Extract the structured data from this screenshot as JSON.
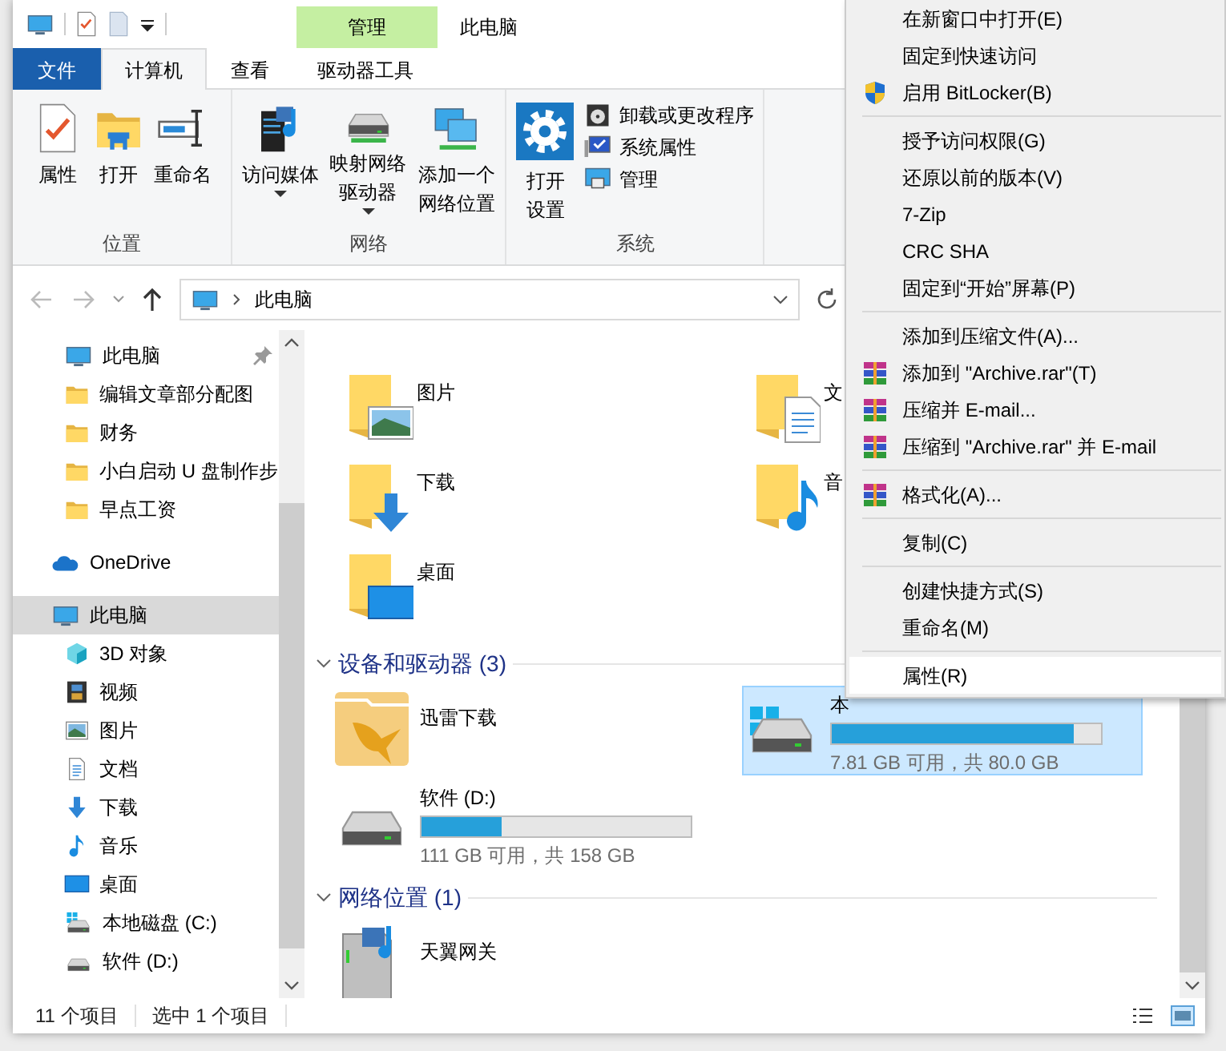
{
  "title_bar": {
    "title": "此电脑",
    "context_tab": "管理"
  },
  "ribbon": {
    "tabs": [
      {
        "label": "文件",
        "kind": "file",
        "selected": false
      },
      {
        "label": "计算机",
        "kind": "tab",
        "selected": true
      },
      {
        "label": "查看",
        "kind": "tab",
        "selected": false
      },
      {
        "label": "驱动器工具",
        "kind": "tab",
        "selected": false
      }
    ],
    "groups": [
      {
        "label": "位置",
        "buttons": [
          {
            "label": "属性",
            "kind": "large",
            "dropdown": false
          },
          {
            "label": "打开",
            "kind": "large",
            "dropdown": false
          },
          {
            "label": "重命名",
            "kind": "large",
            "dropdown": false
          }
        ]
      },
      {
        "label": "网络",
        "buttons": [
          {
            "label": "访问媒体",
            "kind": "large",
            "dropdown": true
          },
          {
            "label": "映射网络驱动器",
            "kind": "large",
            "dropdown": true
          },
          {
            "label": "添加一个网络位置",
            "kind": "large",
            "dropdown": false
          }
        ]
      },
      {
        "label": "系统",
        "buttons": [
          {
            "label": "打开设置",
            "kind": "large",
            "dropdown": false
          },
          {
            "label": "卸载或更改程序",
            "kind": "small"
          },
          {
            "label": "系统属性",
            "kind": "small"
          },
          {
            "label": "管理",
            "kind": "small"
          }
        ]
      }
    ]
  },
  "address_bar": {
    "back_disabled": true,
    "forward_disabled": true,
    "path": "此电脑"
  },
  "nav_pane": {
    "quick_access_items": [
      {
        "label": "此电脑",
        "kind": "computer",
        "pinned": true,
        "selected": false
      },
      {
        "label": "编辑文章部分配图",
        "kind": "folder",
        "pinned": false,
        "selected": false
      },
      {
        "label": "财务",
        "kind": "folder",
        "pinned": false,
        "selected": false
      },
      {
        "label": "小白启动 U 盘制作步",
        "kind": "folder",
        "pinned": false,
        "selected": false
      },
      {
        "label": "早点工资",
        "kind": "folder",
        "pinned": false,
        "selected": false
      }
    ],
    "roots": [
      {
        "label": "OneDrive",
        "kind": "cloud",
        "selected": false
      },
      {
        "label": "此电脑",
        "kind": "computer",
        "selected": true,
        "children": [
          {
            "label": "3D 对象",
            "kind": "cube",
            "selected": false
          },
          {
            "label": "视频",
            "kind": "video",
            "selected": false
          },
          {
            "label": "图片",
            "kind": "pictures",
            "selected": false
          },
          {
            "label": "文档",
            "kind": "documents",
            "selected": false
          },
          {
            "label": "下载",
            "kind": "downloads",
            "selected": false
          },
          {
            "label": "音乐",
            "kind": "music",
            "selected": false
          },
          {
            "label": "桌面",
            "kind": "desktop",
            "selected": false
          },
          {
            "label": "本地磁盘 (C:)",
            "kind": "system-drive",
            "selected": false
          },
          {
            "label": "软件 (D:)",
            "kind": "drive",
            "selected": false
          }
        ]
      }
    ]
  },
  "content": {
    "folders": [
      {
        "label": "图片",
        "kind": "pictures"
      },
      {
        "label": "文",
        "kind": "documents"
      },
      {
        "label": "下载",
        "kind": "downloads"
      },
      {
        "label": "音",
        "kind": "music"
      },
      {
        "label": "桌面",
        "kind": "desktop"
      }
    ],
    "sections": [
      {
        "title": "设备和驱动器 (3)",
        "expanded": true,
        "items": [
          {
            "kind": "app-folder",
            "name": "迅雷下载",
            "selected": false
          },
          {
            "kind": "system-drive",
            "name": "本",
            "level": 0.9,
            "space": "7.81 GB 可用，共 80.0 GB",
            "selected": true
          },
          {
            "kind": "drive",
            "name": "软件 (D:)",
            "level": 0.3,
            "space": "111 GB 可用，共 158 GB",
            "selected": false
          }
        ]
      },
      {
        "title": "网络位置 (1)",
        "expanded": true,
        "items": [
          {
            "kind": "media-device",
            "name": "天翼网关",
            "selected": false
          }
        ]
      }
    ]
  },
  "status_bar": {
    "item_count": "11 个项目",
    "selection": "选中 1 个项目"
  },
  "context_menu": {
    "items": [
      {
        "kind": "item",
        "label": "在新窗口中打开(E)",
        "selected": false
      },
      {
        "kind": "item",
        "label": "固定到快速访问",
        "selected": false
      },
      {
        "kind": "item",
        "label": "启用 BitLocker(B)",
        "selected": false
      },
      {
        "kind": "separator"
      },
      {
        "kind": "item",
        "label": "授予访问权限(G)",
        "selected": false
      },
      {
        "kind": "item",
        "label": "还原以前的版本(V)",
        "selected": false
      },
      {
        "kind": "item",
        "label": "7-Zip",
        "selected": false
      },
      {
        "kind": "item",
        "label": "CRC SHA",
        "selected": false
      },
      {
        "kind": "item",
        "label": "固定到“开始”屏幕(P)",
        "selected": false
      },
      {
        "kind": "separator"
      },
      {
        "kind": "item",
        "label": "添加到压缩文件(A)...",
        "selected": false
      },
      {
        "kind": "item",
        "label": "添加到 \"Archive.rar\"(T)",
        "selected": false
      },
      {
        "kind": "item",
        "label": "压缩并 E-mail...",
        "selected": false
      },
      {
        "kind": "item",
        "label": "压缩到 \"Archive.rar\" 并 E-mail",
        "selected": false
      },
      {
        "kind": "separator"
      },
      {
        "kind": "item",
        "label": "格式化(A)...",
        "selected": false
      },
      {
        "kind": "separator"
      },
      {
        "kind": "item",
        "label": "复制(C)",
        "selected": false
      },
      {
        "kind": "separator"
      },
      {
        "kind": "item",
        "label": "创建快捷方式(S)",
        "selected": false
      },
      {
        "kind": "item",
        "label": "重命名(M)",
        "selected": false
      },
      {
        "kind": "separator"
      },
      {
        "kind": "item",
        "label": "属性(R)",
        "selected": true
      }
    ]
  }
}
